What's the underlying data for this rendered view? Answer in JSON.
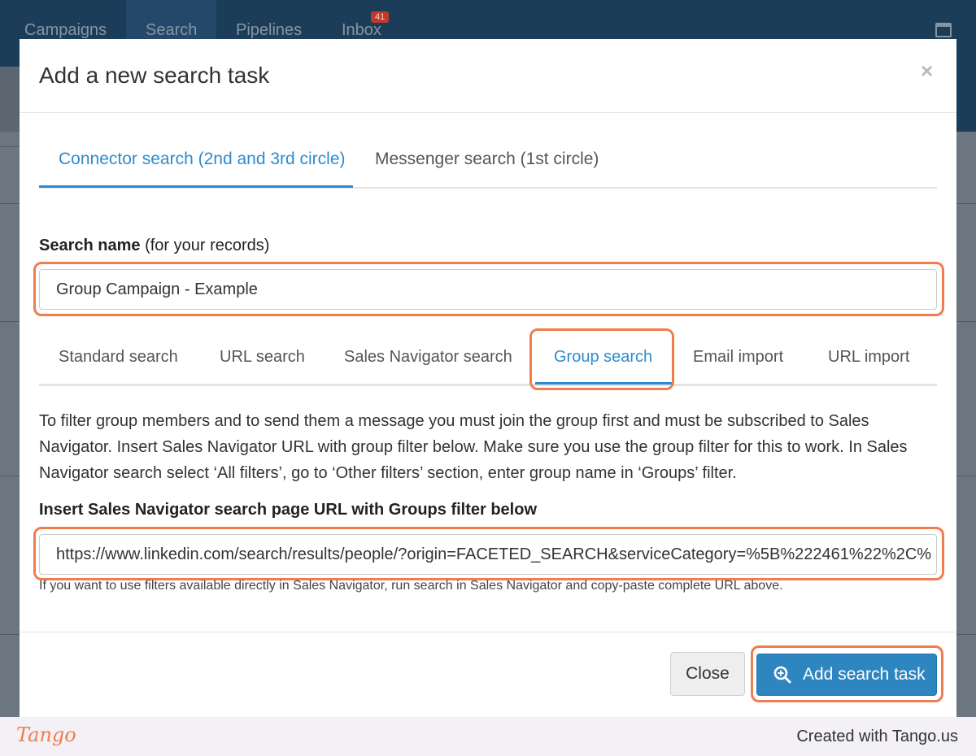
{
  "background_app": {
    "nav": [
      "Campaigns",
      "Search",
      "Pipelines",
      "Inbox"
    ],
    "inbox_badge": "41"
  },
  "modal": {
    "title": "Add a new search task",
    "close_symbol": "×",
    "top_tabs": [
      {
        "label": "Connector search (2nd and 3rd circle)",
        "active": true
      },
      {
        "label": "Messenger search (1st circle)",
        "active": false
      }
    ],
    "search_name_label_bold": "Search name",
    "search_name_label_note": "(for your records)",
    "search_name_value": "Group Campaign - Example",
    "sub_tabs": [
      {
        "label": "Standard search",
        "active": false
      },
      {
        "label": "URL search",
        "active": false
      },
      {
        "label": "Sales Navigator search",
        "active": false
      },
      {
        "label": "Group search",
        "active": true
      },
      {
        "label": "Email import",
        "active": false
      },
      {
        "label": "URL import",
        "active": false
      }
    ],
    "info_text": "To filter group members and to send them a message you must join the group first and must be subscribed to Sales Navigator. Insert Sales Navigator URL with group filter below. Make sure you use the group filter for this to work. In Sales Navigator search select ‘All filters’, go to ‘Other filters’ section, enter group name in ‘Groups’ filter.",
    "url_label": "Insert Sales Navigator search page URL with Groups filter below",
    "url_value": "https://www.linkedin.com/search/results/people/?origin=FACETED_SEARCH&serviceCategory=%5B%222461%22%2C%",
    "help_text": "If you want to use filters available directly in Sales Navigator, run search in Sales Navigator and copy-paste complete URL above.",
    "close_button": "Close",
    "add_button": "Add search task"
  },
  "footer": {
    "logo": "Tango",
    "credit": "Created with Tango.us"
  },
  "colors": {
    "accent": "#2e8bd0",
    "primary_button": "#2e86c1",
    "highlight": "#f07d4e",
    "nav_bg": "#1c3d5a"
  }
}
